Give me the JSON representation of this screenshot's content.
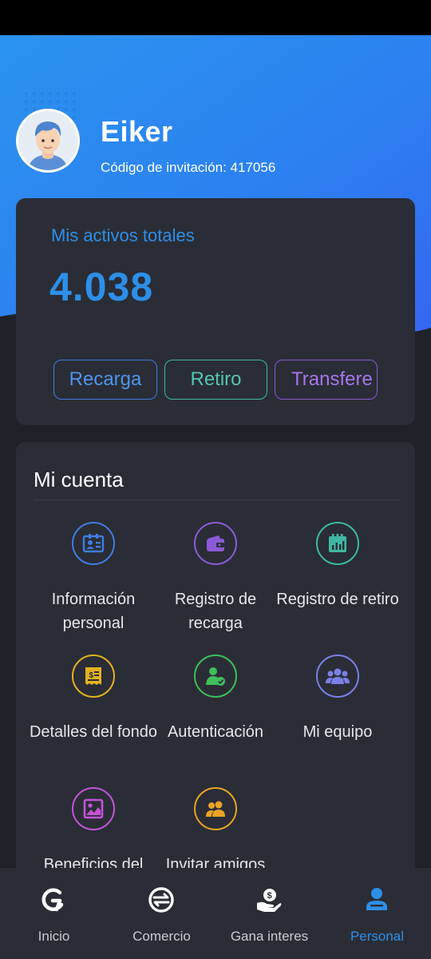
{
  "profile": {
    "name": "Eiker",
    "invite_text": "Código de invitación: 417056"
  },
  "assets": {
    "title": "Mis activos totales",
    "value": "4.038",
    "buttons": {
      "recharge": "Recarga",
      "withdraw": "Retiro",
      "transfer": "Transfere"
    }
  },
  "account": {
    "title": "Mi cuenta",
    "items": [
      {
        "label": "Información personal",
        "icon": "id-card-icon",
        "color": "#3e7ee0"
      },
      {
        "label": "Registro de recarga",
        "icon": "wallet-icon",
        "color": "#8c5ad8"
      },
      {
        "label": "Registro de retiro",
        "icon": "calendar-chart-icon",
        "color": "#3fb8a3"
      },
      {
        "label": "Detalles del fondo",
        "icon": "receipt-dollar-icon",
        "color": "#e3b31f"
      },
      {
        "label": "Autenticación",
        "icon": "user-check-icon",
        "color": "#3fbf5a"
      },
      {
        "label": "Mi equipo",
        "icon": "team-icon",
        "color": "#7b80e8"
      },
      {
        "label": "Beneficios del",
        "icon": "image-chart-icon",
        "color": "#c454d8"
      },
      {
        "label": "Invitar amigos",
        "icon": "friends-icon",
        "color": "#e9a426"
      }
    ]
  },
  "nav": {
    "items": [
      {
        "label": "Inicio",
        "icon": "home-logo-icon"
      },
      {
        "label": "Comercio",
        "icon": "exchange-icon"
      },
      {
        "label": "Gana interes",
        "icon": "hand-coin-icon"
      },
      {
        "label": "Personal",
        "icon": "person-icon",
        "active": true
      }
    ]
  },
  "colors": {
    "accent": "#2d8fe8",
    "background": "#1f2128",
    "card": "#2a2d36"
  }
}
